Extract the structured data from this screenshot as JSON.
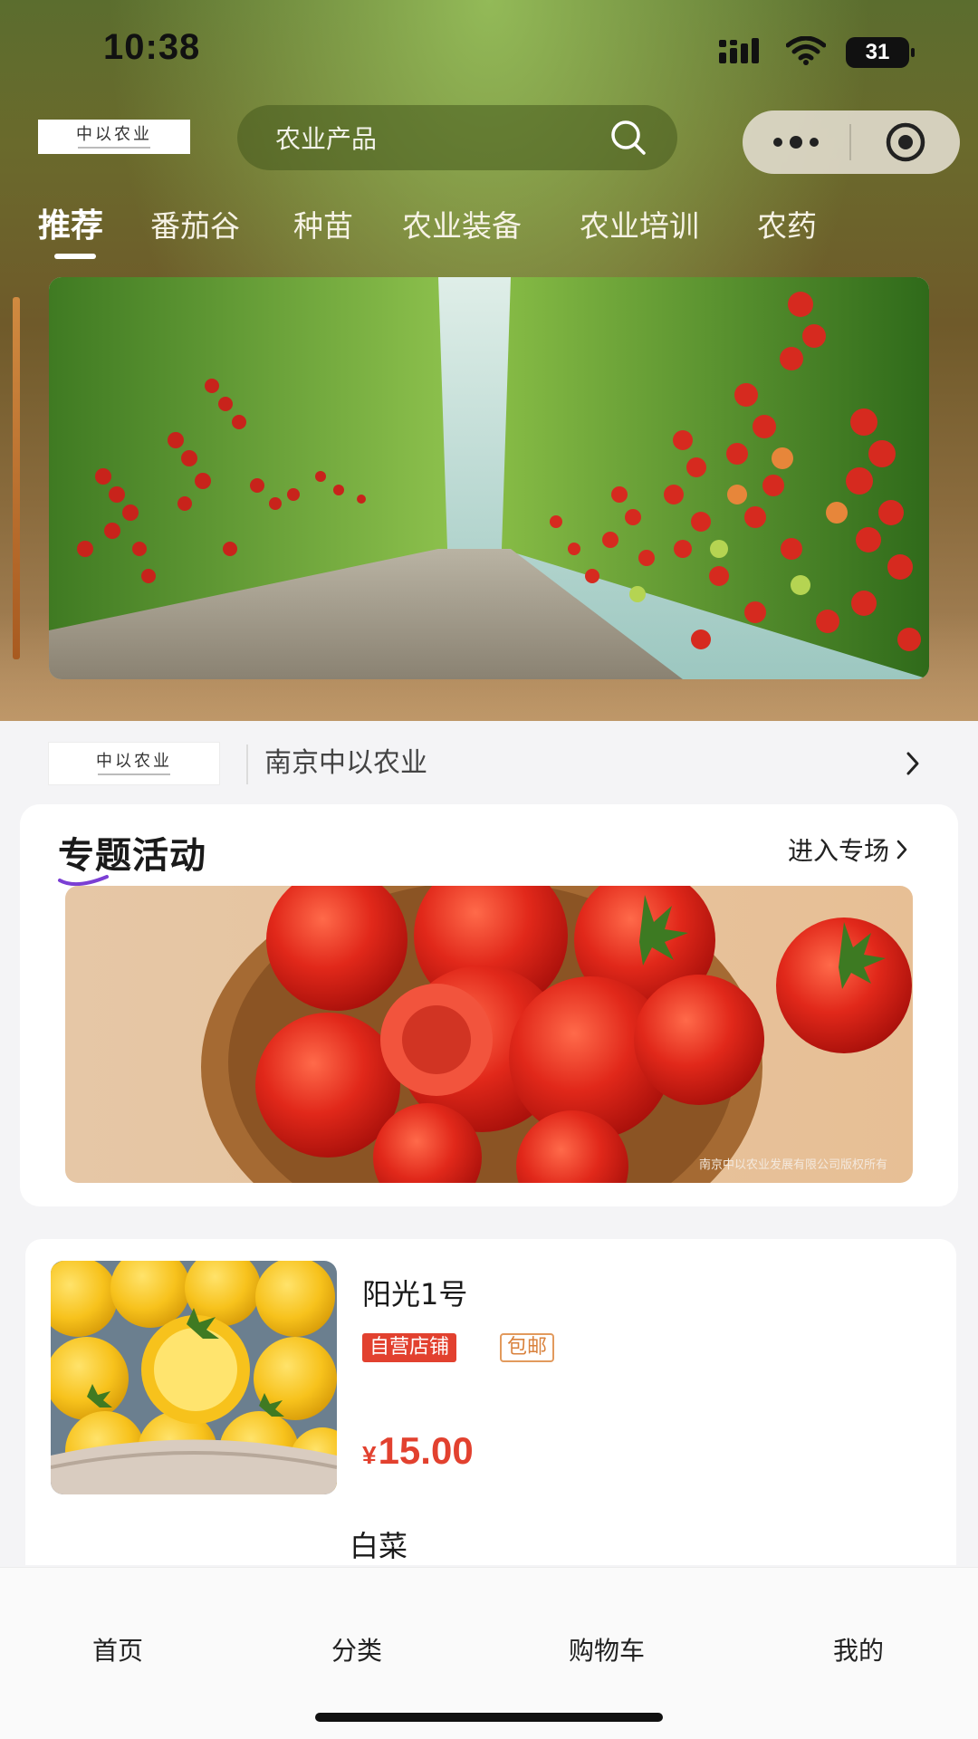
{
  "status_bar": {
    "time": "10:38",
    "battery": "31",
    "icons": [
      "cellular-signal-icon",
      "wifi-icon",
      "battery-icon"
    ]
  },
  "header": {
    "logo_text": "中以农业",
    "search_placeholder": "农业产品",
    "search_icon": "search-icon",
    "capsule_icons": [
      "more-dots-icon",
      "target-circle-icon"
    ]
  },
  "tabs": [
    {
      "label": "推荐",
      "active": true
    },
    {
      "label": "番茄谷",
      "active": false
    },
    {
      "label": "种苗",
      "active": false
    },
    {
      "label": "农业装备",
      "active": false
    },
    {
      "label": "农业培训",
      "active": false
    },
    {
      "label": "农药",
      "active": false
    }
  ],
  "banner": {
    "image": "greenhouse-cherry-tomato-rows-photo"
  },
  "shop": {
    "logo_text": "中以农业",
    "name": "南京中以农业",
    "chevron_icon": "chevron-right-icon"
  },
  "event": {
    "title": "专题活动",
    "enter_label": "进入专场",
    "image": "red-tomatoes-in-basket-photo",
    "watermark": "南京中以农业发展有限公司版权所有"
  },
  "products": [
    {
      "name": "阳光1号",
      "badges": [
        "自营店铺",
        "包邮"
      ],
      "currency": "¥",
      "price": "15.00",
      "image": "yellow-tomatoes-in-basket-photo"
    },
    {
      "name": "白菜"
    }
  ],
  "bottom_nav": [
    {
      "label": "首页"
    },
    {
      "label": "分类"
    },
    {
      "label": "购物车"
    },
    {
      "label": "我的"
    }
  ],
  "colors": {
    "price_red": "#e2412f",
    "badge_red": "#e2412f",
    "badge_orange": "#d9823d",
    "page_bg": "#f4f4f6"
  }
}
